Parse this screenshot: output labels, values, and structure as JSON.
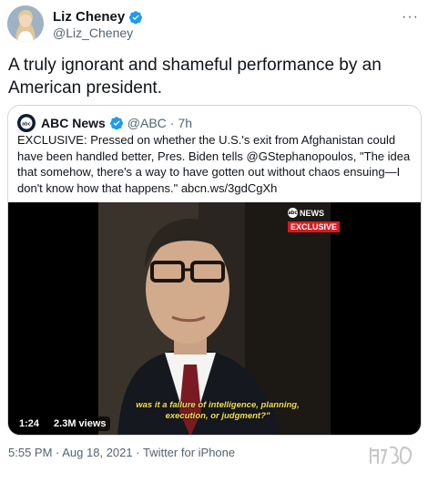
{
  "author": {
    "display_name": "Liz Cheney",
    "handle": "@Liz_Cheney"
  },
  "tweet_text": "A truly ignorant and shameful performance by an American president.",
  "quoted": {
    "display_name": "ABC News",
    "handle": "@ABC",
    "separator": "·",
    "age": "7h",
    "text": "EXCLUSIVE: Pressed on whether the U.S.'s exit from Afghanistan could have been handled better, Pres. Biden tells @GStephanopoulos, \"The idea that somehow, there's a way to have gotten out without chaos ensuing—I don't know how that happens.\" abcn.ws/3gdCgXh",
    "video": {
      "network_label": "NEWS",
      "network_mark": "abc",
      "badge": "EXCLUSIVE",
      "caption_line1": "was it a failure of intelligence, planning,",
      "caption_line2": "execution, or judgment?\"",
      "duration": "1:24",
      "views": "2.3M views"
    }
  },
  "meta": {
    "time": "5:55 PM",
    "sep1": " · ",
    "date": "Aug 18, 2021",
    "sep2": " · ",
    "client": "Twitter for iPhone"
  },
  "icons": {
    "verified": "verified-badge-icon",
    "more": "more-options-icon"
  },
  "colors": {
    "verified_blue": "#1d9bf0",
    "secondary_text": "#536471",
    "exclusive_red": "#d71920",
    "caption_yellow": "#f3e34a"
  }
}
